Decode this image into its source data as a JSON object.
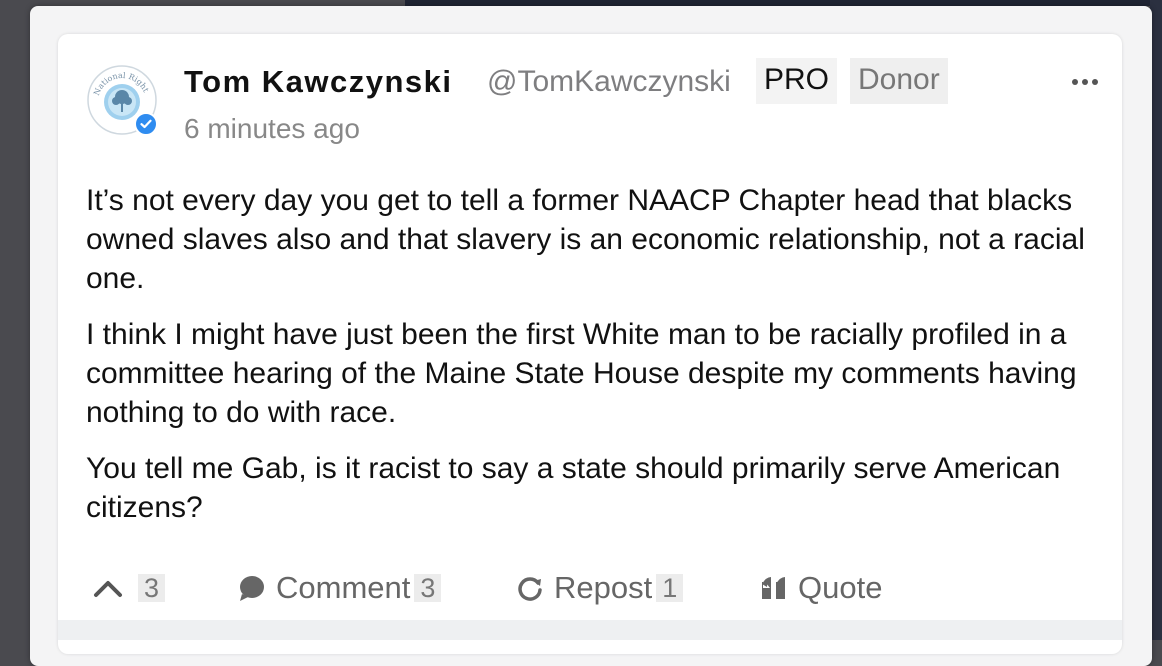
{
  "post": {
    "author_name": "Tom Kawczynski",
    "author_handle": "@TomKawczynski",
    "badges": [
      "PRO",
      "Donor"
    ],
    "timestamp": "6 minutes ago",
    "avatar_label": "National Right",
    "paragraphs": [
      "It’s not every day you get to tell a former NAACP Chapter head that blacks owned slaves also and that slavery is an economic relationship, not a racial one.",
      "I think I might have just been the first White man to be racially profiled in a committee hearing of the Maine State House despite my comments having nothing to do with race.",
      "You tell me Gab, is it racist to say a state should primarily serve American citizens?"
    ]
  },
  "actions": {
    "upvote_count": "3",
    "comment_label": "Comment",
    "comment_count": "3",
    "repost_label": "Repost",
    "repost_count": "1",
    "quote_label": "Quote"
  },
  "icons": {
    "verified": "check-badge-icon",
    "more": "ellipsis-icon",
    "upvote": "chevron-up-icon",
    "comment": "speech-bubble-icon",
    "repost": "refresh-icon",
    "quote": "quote-icon"
  },
  "colors": {
    "verified_blue": "#2f8cf0",
    "text": "#111111",
    "muted": "#7e7e80"
  }
}
